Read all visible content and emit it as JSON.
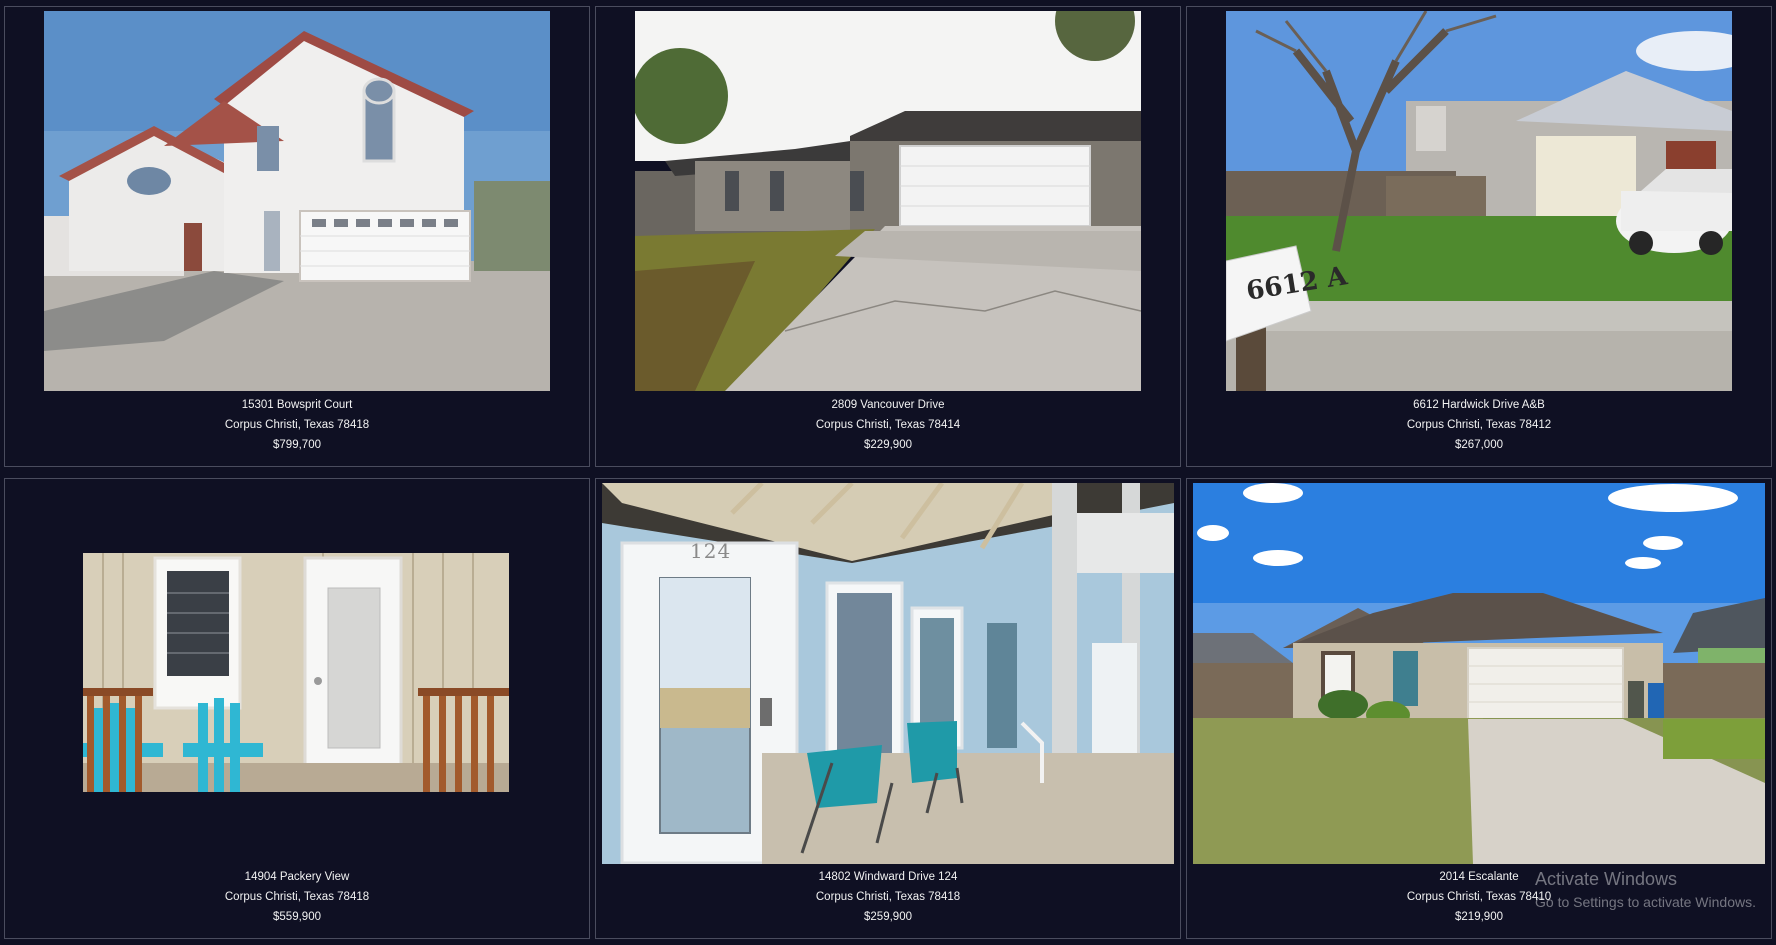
{
  "listings": [
    {
      "address": "15301 Bowsprit Court",
      "city": "Corpus Christi, Texas 78418",
      "price": "$799,700"
    },
    {
      "address": "2809 Vancouver Drive",
      "city": "Corpus Christi, Texas 78414",
      "price": "$229,900"
    },
    {
      "address": "6612 Hardwick Drive A&B",
      "city": "Corpus Christi, Texas 78412",
      "price": "$267,000"
    },
    {
      "address": "14904 Packery View",
      "city": "Corpus Christi, Texas 78418",
      "price": "$559,900"
    },
    {
      "address": "14802 Windward Drive 124",
      "city": "Corpus Christi, Texas 78418",
      "price": "$259,900"
    },
    {
      "address": "2014 Escalante",
      "city": "Corpus Christi, Texas 78410",
      "price": "$219,900"
    }
  ],
  "photo_text": {
    "mailbox_number": "6612 A",
    "door_number": "124"
  },
  "watermark": {
    "title": "Activate Windows",
    "subtitle": "Go to Settings to activate Windows."
  },
  "colors": {
    "background": "#0f1023",
    "card_border": "#4a4c5e",
    "caption_text": "#f2f2f2"
  }
}
